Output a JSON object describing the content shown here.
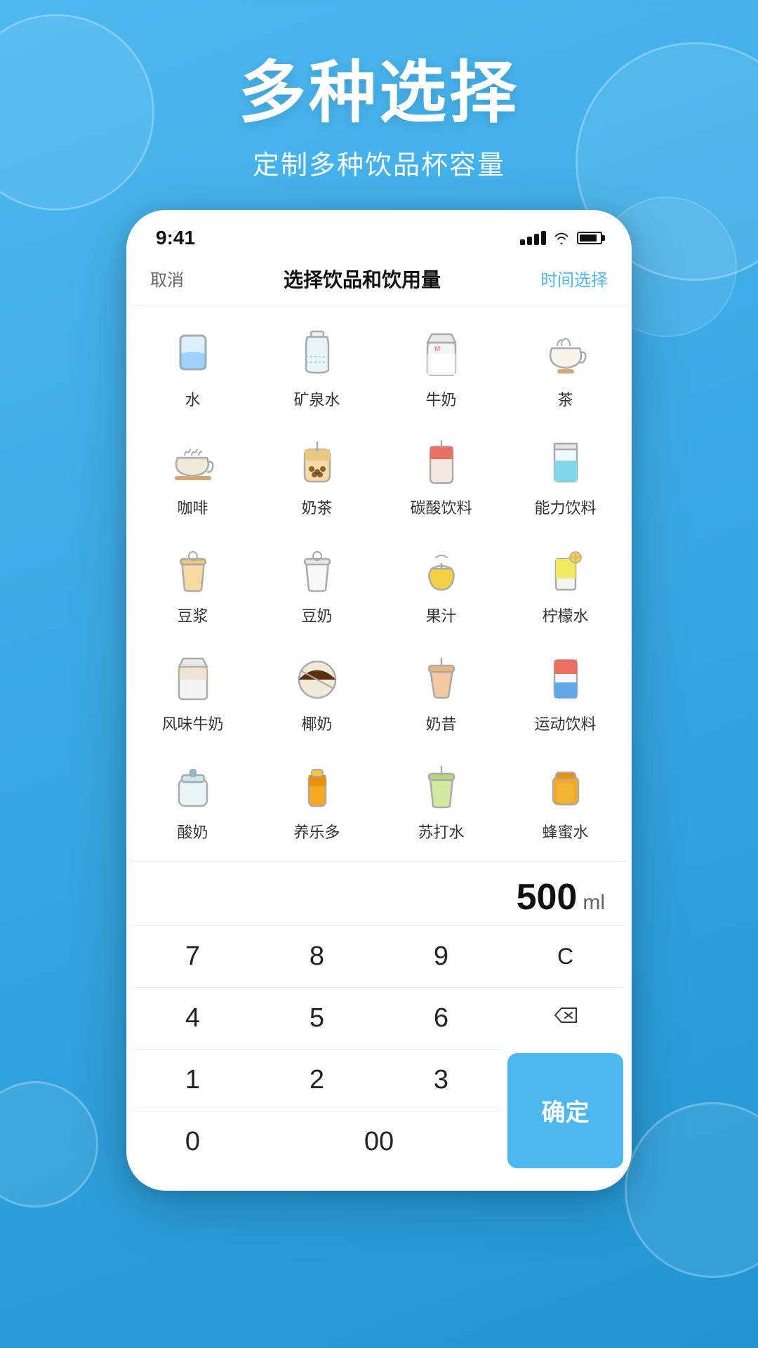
{
  "background": {
    "gradient_start": "#4db8f0",
    "gradient_end": "#2196d3"
  },
  "hero": {
    "title": "多种选择",
    "subtitle": "定制多种饮品杯容量"
  },
  "status_bar": {
    "time": "9:41",
    "signal": "signal",
    "wifi": "wifi",
    "battery": "battery"
  },
  "nav": {
    "cancel": "取消",
    "title": "选择饮品和饮用量",
    "time_select": "时间选择"
  },
  "drinks": [
    {
      "id": "water",
      "name": "水",
      "icon": "water"
    },
    {
      "id": "mineral-water",
      "name": "矿泉水",
      "icon": "mineral-water"
    },
    {
      "id": "milk",
      "name": "牛奶",
      "icon": "milk"
    },
    {
      "id": "tea",
      "name": "茶",
      "icon": "tea"
    },
    {
      "id": "coffee",
      "name": "咖啡",
      "icon": "coffee"
    },
    {
      "id": "milk-tea",
      "name": "奶茶",
      "icon": "milk-tea"
    },
    {
      "id": "soda",
      "name": "碳酸饮料",
      "icon": "soda"
    },
    {
      "id": "energy",
      "name": "能力饮料",
      "icon": "energy"
    },
    {
      "id": "soymilk-warm",
      "name": "豆浆",
      "icon": "soymilk-warm"
    },
    {
      "id": "soymilk",
      "name": "豆奶",
      "icon": "soymilk"
    },
    {
      "id": "juice",
      "name": "果汁",
      "icon": "juice"
    },
    {
      "id": "lemon-water",
      "name": "柠檬水",
      "icon": "lemon-water"
    },
    {
      "id": "flavored-milk",
      "name": "风味牛奶",
      "icon": "flavored-milk"
    },
    {
      "id": "coconut-milk",
      "name": "椰奶",
      "icon": "coconut-milk"
    },
    {
      "id": "smoothie",
      "name": "奶昔",
      "icon": "smoothie"
    },
    {
      "id": "sports",
      "name": "运动饮料",
      "icon": "sports"
    },
    {
      "id": "yogurt",
      "name": "酸奶",
      "icon": "yogurt"
    },
    {
      "id": "yakult",
      "name": "养乐多",
      "icon": "yakult"
    },
    {
      "id": "soda-water",
      "name": "苏打水",
      "icon": "soda-water"
    },
    {
      "id": "honey-water",
      "name": "蜂蜜水",
      "icon": "honey-water"
    }
  ],
  "amount": {
    "value": "500",
    "unit": "ml"
  },
  "numpad": {
    "buttons": [
      "7",
      "8",
      "9",
      "C",
      "4",
      "5",
      "6",
      "⌫",
      "1",
      "2",
      "3",
      "0",
      "00"
    ],
    "confirm": "确定"
  }
}
